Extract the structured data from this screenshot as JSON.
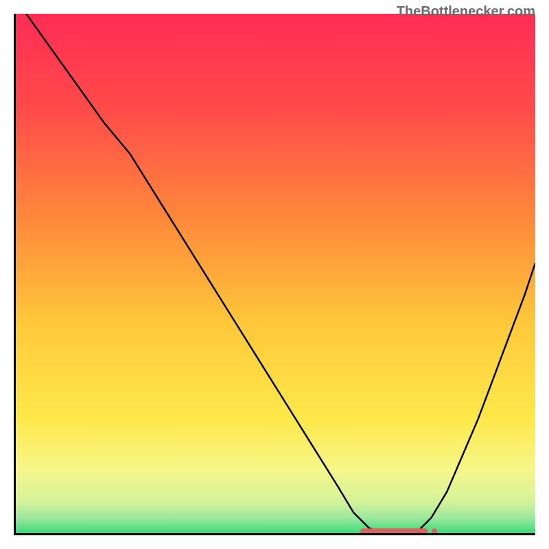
{
  "watermark": "TheBottlenecker.com",
  "chart_data": {
    "type": "line",
    "title": "",
    "xlabel": "",
    "ylabel": "",
    "xlim": [
      0,
      100
    ],
    "ylim": [
      0,
      100
    ],
    "x": [
      2,
      7,
      12,
      17,
      22,
      27,
      32,
      37,
      42,
      47,
      52,
      57,
      62,
      65,
      68,
      71,
      74,
      77,
      80,
      83,
      86,
      89,
      92,
      95,
      98,
      100
    ],
    "values": [
      100,
      93,
      86,
      79,
      73,
      65,
      57,
      49,
      41,
      33,
      25,
      17,
      9,
      4,
      1,
      0,
      0,
      0,
      3,
      8,
      15,
      22,
      30,
      38,
      46,
      52
    ],
    "minimum_region": {
      "x_start": 66,
      "x_end": 79,
      "y": 0
    },
    "gradient_stops": [
      {
        "pct": 0,
        "color": "#ff2c55"
      },
      {
        "pct": 18,
        "color": "#ff4a4a"
      },
      {
        "pct": 40,
        "color": "#ff8a3a"
      },
      {
        "pct": 60,
        "color": "#ffc93a"
      },
      {
        "pct": 78,
        "color": "#ffe84a"
      },
      {
        "pct": 88,
        "color": "#f5f78a"
      },
      {
        "pct": 94,
        "color": "#d4f29a"
      },
      {
        "pct": 97,
        "color": "#9de89e"
      },
      {
        "pct": 100,
        "color": "#3fd97a"
      }
    ]
  }
}
